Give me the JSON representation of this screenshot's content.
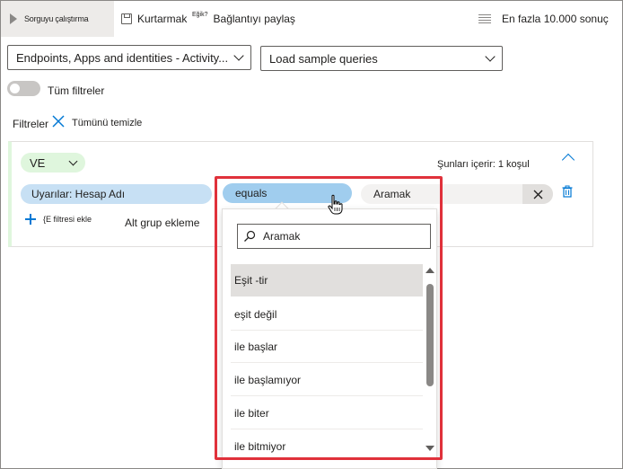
{
  "toolbar": {
    "run_label": "Sorguyu çalıştırma",
    "save_label": "Kurtarmak",
    "share_icon_text": "Eğik?",
    "share_label": "Bağlantıyı paylaş",
    "limit_label": "En fazla 10.000 sonuç"
  },
  "dropdowns": {
    "schema_value": "Endpoints, Apps and identities - Activity...",
    "sample_queries_value": "Load sample queries"
  },
  "filters": {
    "toggle_label": "Tüm filtreler",
    "filters_label": "Filtreler",
    "clear_all_label": "Tümünü temizle"
  },
  "group": {
    "operator": "VE",
    "condition_count_label": "Şunları içerir: 1 koşul",
    "field": "Uyarılar: Hesap Adı",
    "comparison": "equals",
    "value_placeholder": "Aramak",
    "add_filter_label": "{E filtresi ekle",
    "add_subgroup_label": "Alt grup ekleme"
  },
  "popup": {
    "search_placeholder": "Aramak",
    "options": [
      {
        "label": "Eşit -tir",
        "selected": true
      },
      {
        "label": "eşit değil",
        "selected": false
      },
      {
        "label": "ile başlar",
        "selected": false
      },
      {
        "label": "ile başlamıyor",
        "selected": false
      },
      {
        "label": "ile biter",
        "selected": false
      },
      {
        "label": "ile bitmiyor",
        "selected": false
      }
    ]
  },
  "colors": {
    "accent": "#0078d4",
    "highlight": "#e0313b",
    "group_pill": "#dff6dd",
    "field_pill": "#c7e0f4",
    "operator_pill": "#a0cdee"
  }
}
